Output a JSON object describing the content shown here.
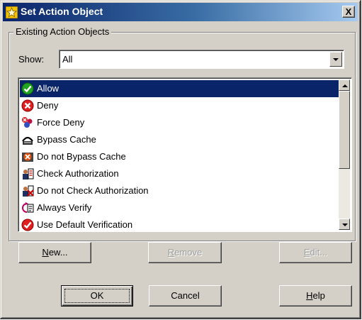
{
  "window": {
    "title": "Set Action Object",
    "close_label": "X"
  },
  "group": {
    "label": "Existing Action Objects",
    "show_label": "Show:",
    "show_value": "All"
  },
  "list": {
    "items": [
      {
        "label": "Allow",
        "icon": "green-check-icon",
        "selected": true
      },
      {
        "label": "Deny",
        "icon": "red-x-circle-icon",
        "selected": false
      },
      {
        "label": "Force Deny",
        "icon": "force-deny-icon",
        "selected": false
      },
      {
        "label": "Bypass Cache",
        "icon": "bypass-cache-icon",
        "selected": false
      },
      {
        "label": "Do not Bypass Cache",
        "icon": "do-not-bypass-cache-icon",
        "selected": false
      },
      {
        "label": "Check Authorization",
        "icon": "check-authorization-icon",
        "selected": false
      },
      {
        "label": "Do not Check Authorization",
        "icon": "do-not-check-authorization-icon",
        "selected": false
      },
      {
        "label": "Always Verify",
        "icon": "always-verify-icon",
        "selected": false
      },
      {
        "label": "Use Default Verification",
        "icon": "default-verification-icon",
        "selected": false
      }
    ]
  },
  "actions": {
    "new_label": "New...",
    "remove_label": "Remove",
    "edit_label": "Edit..."
  },
  "footer": {
    "ok_label": "OK",
    "cancel_label": "Cancel",
    "help_label": "Help"
  },
  "colors": {
    "selection": "#0a246a",
    "titlebar_start": "#0a246a",
    "titlebar_end": "#a6caf0",
    "dialog_face": "#d4d0c8"
  }
}
